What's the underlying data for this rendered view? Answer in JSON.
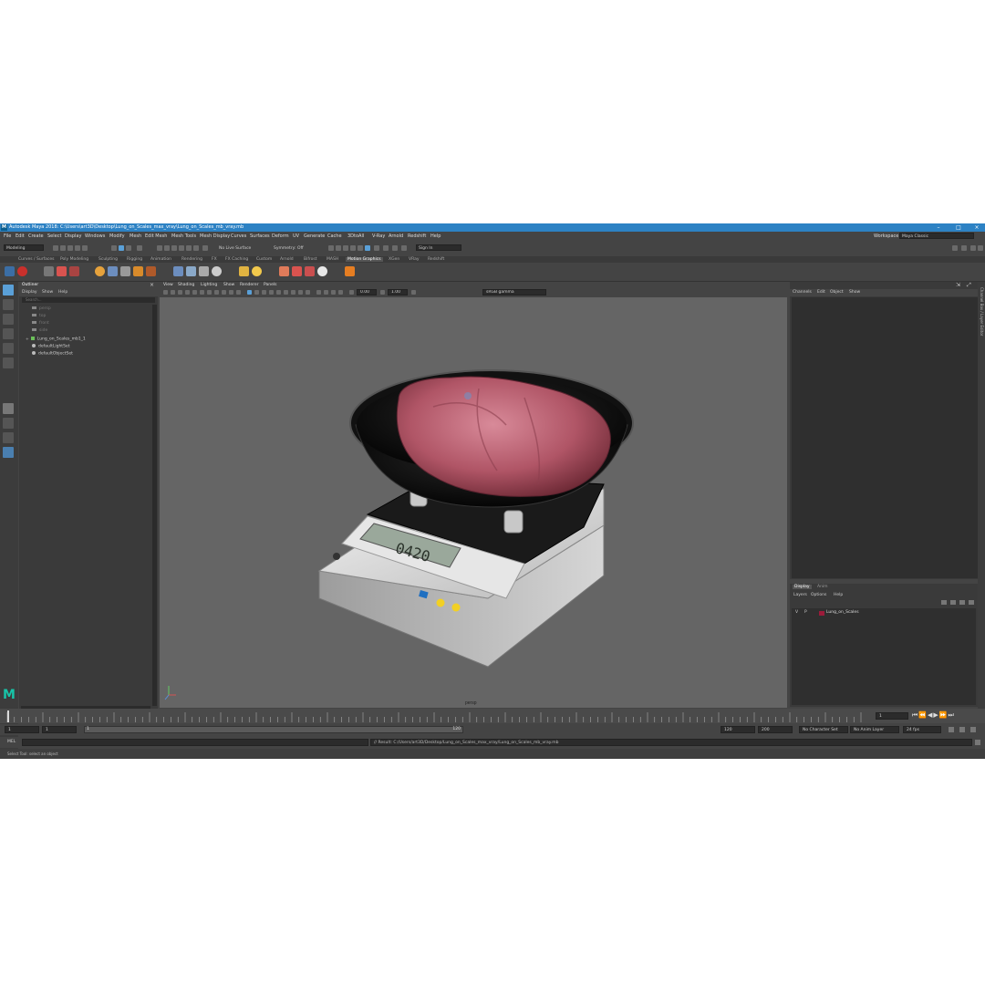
{
  "window": {
    "title": "Autodesk Maya 2018: C:\\Users\\art3D\\Desktop\\Lung_on_Scales_max_vray\\Lung_on_Scales_mb_vray.mb",
    "logo": "M"
  },
  "menubar": [
    "File",
    "Edit",
    "Create",
    "Select",
    "Display",
    "Windows",
    "Modify",
    "Mesh",
    "Edit Mesh",
    "Mesh Tools",
    "Mesh Display",
    "Curves",
    "Surfaces",
    "Deform",
    "UV",
    "Generate",
    "Cache",
    "3DtoAll",
    "V-Ray",
    "Arnold",
    "Redshift",
    "Help"
  ],
  "workspace": {
    "label": "Workspace :",
    "value": "Maya Classic"
  },
  "status": {
    "mode": "Modeling",
    "live": "No Live Surface",
    "symmetry": "Symmetry: Off",
    "signin": "Sign In"
  },
  "shelf_tabs": [
    "Curves / Surfaces",
    "Poly Modeling",
    "Sculpting",
    "Rigging",
    "Animation",
    "Rendering",
    "FX",
    "FX Caching",
    "Custom",
    "Arnold",
    "Bifrost",
    "MASH",
    "Motion Graphics",
    "XGen",
    "VRay",
    "Redshift"
  ],
  "shelf_active": "Motion Graphics",
  "outliner": {
    "title": "Outliner",
    "menu": [
      "Display",
      "Show",
      "Help"
    ],
    "search": "Search...",
    "items": [
      {
        "label": "persp",
        "dim": true
      },
      {
        "label": "top",
        "dim": true
      },
      {
        "label": "front",
        "dim": true
      },
      {
        "label": "side",
        "dim": true
      },
      {
        "label": "Lung_on_Scales_mb1_1",
        "dim": false
      },
      {
        "label": "defaultLightSet",
        "dim": false
      },
      {
        "label": "defaultObjectSet",
        "dim": false
      }
    ]
  },
  "viewport": {
    "menu": [
      "View",
      "Shading",
      "Lighting",
      "Show",
      "Renderer",
      "Panels"
    ],
    "exposure": "0.00",
    "gamma": "1.00",
    "colorspace": "sRGB gamma",
    "camera_label": "persp",
    "scale_display": "0420"
  },
  "channelbox": {
    "menu": [
      "Channels",
      "Edit",
      "Object",
      "Show"
    ]
  },
  "layers": {
    "tabs": [
      "Display",
      "Anim"
    ],
    "menu": [
      "Layers",
      "Options",
      "Help"
    ],
    "row": {
      "v": "V",
      "p": "P",
      "name": "Lung_on_Scales",
      "color": "#9b1b3a"
    }
  },
  "attr_strip": "Channel Box / Layer Editor",
  "timeline": {
    "start_frame": "1",
    "current": "1"
  },
  "range": {
    "start": "1",
    "inner_start": "1",
    "slider_start": "1",
    "slider_end": "120",
    "end": "120",
    "max_end": "200",
    "character": "No Character Set",
    "anim_layer": "No Anim Layer",
    "fps": "24 fps"
  },
  "cmdline": {
    "label": "MEL",
    "result": "// Result: C:/Users/art3D/Desktop/Lung_on_Scales_max_vray/Lung_on_Scales_mb_vray.mb"
  },
  "helpline": "Select Tool: select an object",
  "colors": {
    "titlebar": "#2d82c4",
    "panel": "#444444",
    "viewport_bg": "#656565",
    "accent": "#5aa0d8"
  }
}
